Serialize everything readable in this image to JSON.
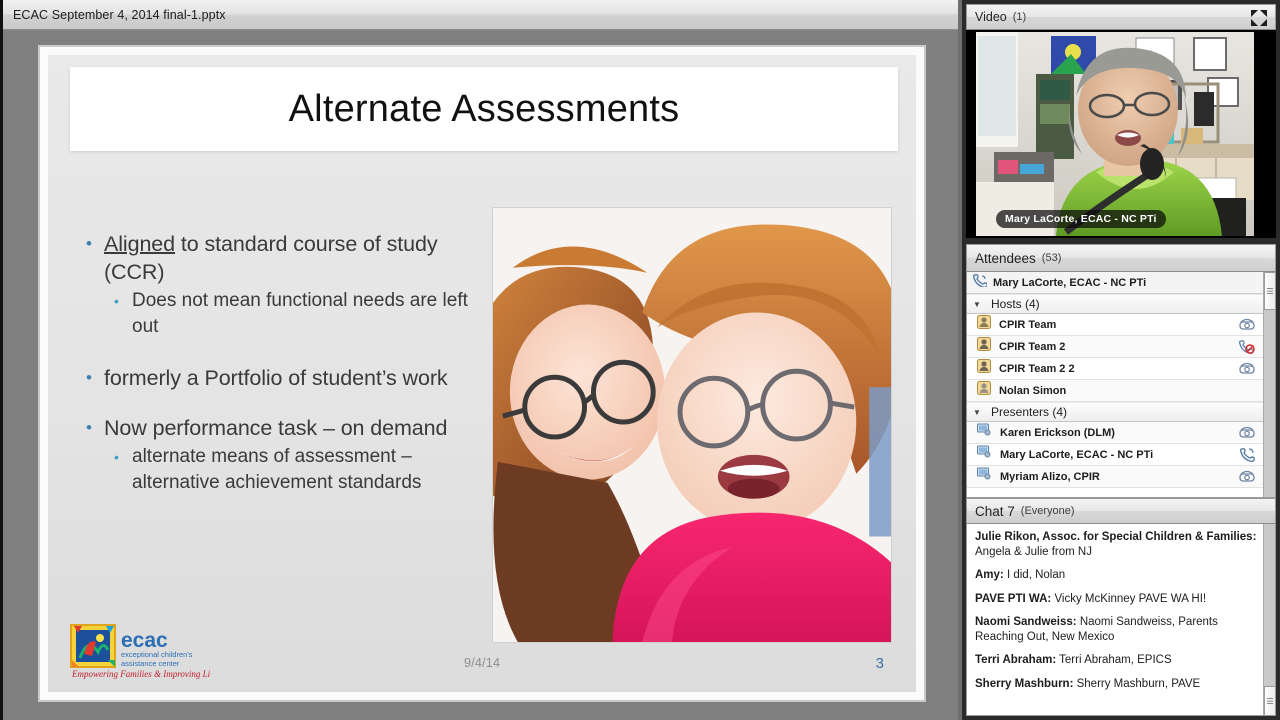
{
  "window": {
    "title": "ECAC September 4,  2014 final-1.pptx"
  },
  "slide": {
    "title": "Alternate Assessments",
    "bullets": [
      {
        "level": 1,
        "text_before": "",
        "underlined": "Aligned",
        "text_after": " to standard course of study (CCR)"
      },
      {
        "level": 2,
        "text": "Does not mean functional needs are left out"
      },
      {
        "level": 1,
        "text": "formerly a Portfolio of student’s work"
      },
      {
        "level": 1,
        "text": "Now performance task – on demand"
      },
      {
        "level": 2,
        "text": "alternate means of assessment – alternative achievement standards"
      }
    ],
    "footer": {
      "date": "9/4/14",
      "page_number": "3"
    },
    "logo": {
      "word": "ecac",
      "line1": "exceptional children's",
      "line2": "assistance center",
      "tagline": "Empowering Families & Improving Lives"
    },
    "photo_alt": "woman and young girl with glasses smiling"
  },
  "video_panel": {
    "title": "Video",
    "count": "(1)",
    "speaker_label": "Mary LaCorte, ECAC - NC PTi",
    "expand_icon": "fullscreen-icon"
  },
  "attendees_panel": {
    "title": "Attendees",
    "count": "(53)",
    "self": {
      "name": "Mary LaCorte, ECAC - NC PTi",
      "icon": "phone-icon"
    },
    "groups": [
      {
        "label": "Hosts (4)",
        "caret": "▼",
        "members": [
          {
            "name": "CPIR Team",
            "icon": "attendee-icon",
            "status_icon": "telephone-icon"
          },
          {
            "name": "CPIR Team 2",
            "icon": "attendee-icon",
            "status_icon": "telephone-muted-icon"
          },
          {
            "name": "CPIR Team 2 2",
            "icon": "attendee-icon",
            "status_icon": "telephone-icon"
          },
          {
            "name": "Nolan Simon",
            "icon": "attendee-icon",
            "status_icon": ""
          }
        ]
      },
      {
        "label": "Presenters (4)",
        "caret": "▼",
        "members": [
          {
            "name": "Karen Erickson (DLM)",
            "icon": "presenter-icon",
            "status_icon": "telephone-icon"
          },
          {
            "name": "Mary LaCorte, ECAC - NC PTi",
            "icon": "presenter-icon",
            "status_icon": "telephone-handset-icon"
          },
          {
            "name": "Myriam Alizo, CPIR",
            "icon": "presenter-icon",
            "status_icon": "telephone-icon"
          }
        ]
      }
    ]
  },
  "chat_panel": {
    "title": "Chat 7",
    "scope": "(Everyone)",
    "messages": [
      {
        "who": "Julie Rikon, Assoc. for Special Children & Families:",
        "text": " Angela & Julie from NJ"
      },
      {
        "who": "Amy:",
        "text": " I did, Nolan"
      },
      {
        "who": "PAVE PTI  WA:",
        "text": " Vicky McKinney PAVE WA   HI!"
      },
      {
        "who": "Naomi Sandweiss:",
        "text": " Naomi Sandweiss, Parents Reaching Out, New Mexico"
      },
      {
        "who": "Terri Abraham:",
        "text": " Terri Abraham, EPICS"
      },
      {
        "who": "Sherry Mashburn:",
        "text": " Sherry Mashburn, PAVE"
      }
    ]
  },
  "colors": {
    "bullet_level1": "#3c7fb1",
    "bullet_level2": "#3c9fc4",
    "page_number": "#3d6fa5",
    "logo_blue": "#2a6fb5",
    "logo_red": "#c4202c"
  }
}
